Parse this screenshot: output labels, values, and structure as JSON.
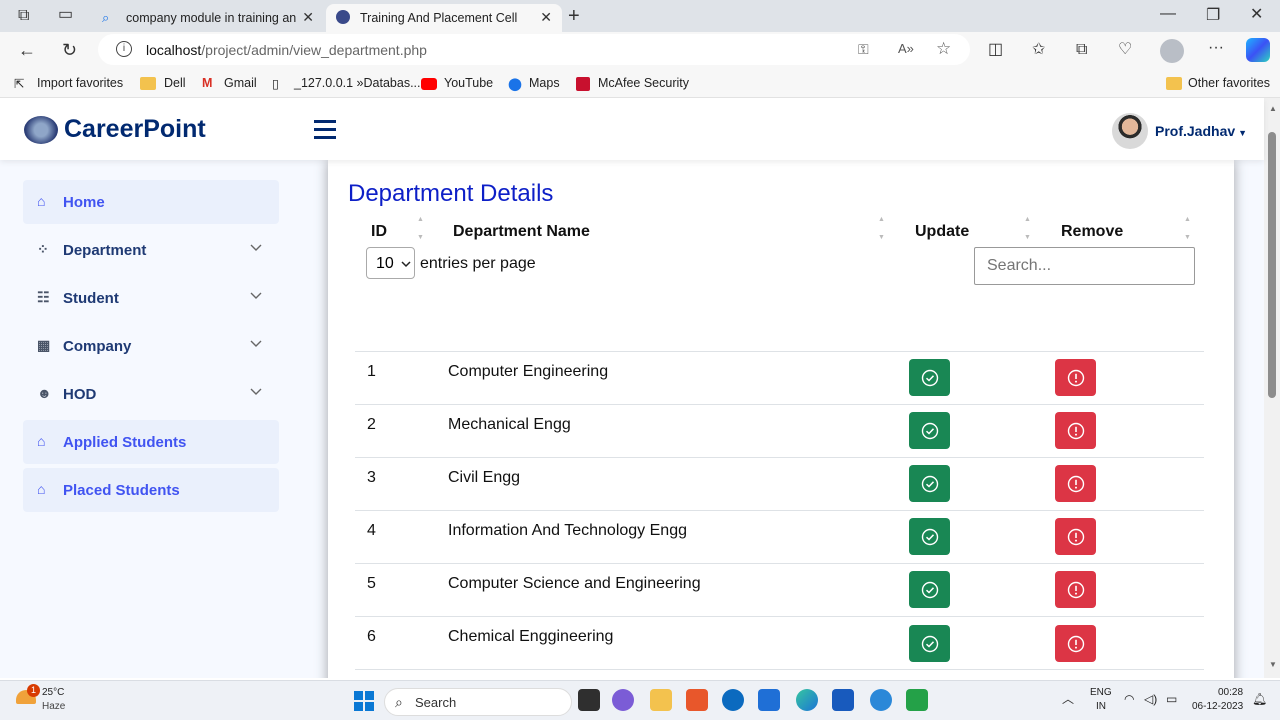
{
  "browser": {
    "tabs": [
      {
        "title": "company module in training and"
      },
      {
        "title": "Training And Placement Cell"
      }
    ],
    "url_host": "localhost",
    "url_path": "/project/admin/view_department.php",
    "favorites": [
      "Import favorites",
      "Dell",
      "Gmail",
      "_127.0.0.1 »Databas...",
      "YouTube",
      "Maps",
      "McAfee Security"
    ],
    "other_favorites": "Other favorites"
  },
  "app": {
    "brand": "CareerPoint",
    "user_name": "Prof.Jadhav"
  },
  "sidebar": {
    "items": [
      {
        "label": "Home",
        "icon": "home-icon",
        "expandable": false
      },
      {
        "label": "Department",
        "icon": "grid-icon",
        "expandable": true
      },
      {
        "label": "Student",
        "icon": "people-icon",
        "expandable": true
      },
      {
        "label": "Company",
        "icon": "building-icon",
        "expandable": true
      },
      {
        "label": "HOD",
        "icon": "person-icon",
        "expandable": true
      },
      {
        "label": "Applied Students",
        "icon": "bank-icon",
        "expandable": false
      },
      {
        "label": "Placed Students",
        "icon": "bank-icon",
        "expandable": false
      }
    ]
  },
  "main": {
    "title": "Department Details",
    "entries_value": "10",
    "entries_label": "entries per page",
    "search_placeholder": "Search...",
    "columns": [
      "ID",
      "Department Name",
      "Update",
      "Remove"
    ],
    "rows": [
      {
        "id": "1",
        "name": "Computer Engineering"
      },
      {
        "id": "2",
        "name": "Mechanical Engg"
      },
      {
        "id": "3",
        "name": "Civil Engg"
      },
      {
        "id": "4",
        "name": "Information And Technology Engg"
      },
      {
        "id": "5",
        "name": "Computer Science and Engineering"
      },
      {
        "id": "6",
        "name": "Chemical Enggineering"
      }
    ]
  },
  "taskbar": {
    "weather_temp": "25°C",
    "weather_desc": "Haze",
    "weather_badge": "1",
    "search_label": "Search",
    "lang_top": "ENG",
    "lang_bottom": "IN",
    "time": "00:28",
    "date": "06-12-2023"
  },
  "colors": {
    "brand": "#012970",
    "title_blue": "#0d1fc7",
    "update_green": "#198754",
    "remove_red": "#dc3545",
    "nav_highlight": "#4154f1"
  }
}
